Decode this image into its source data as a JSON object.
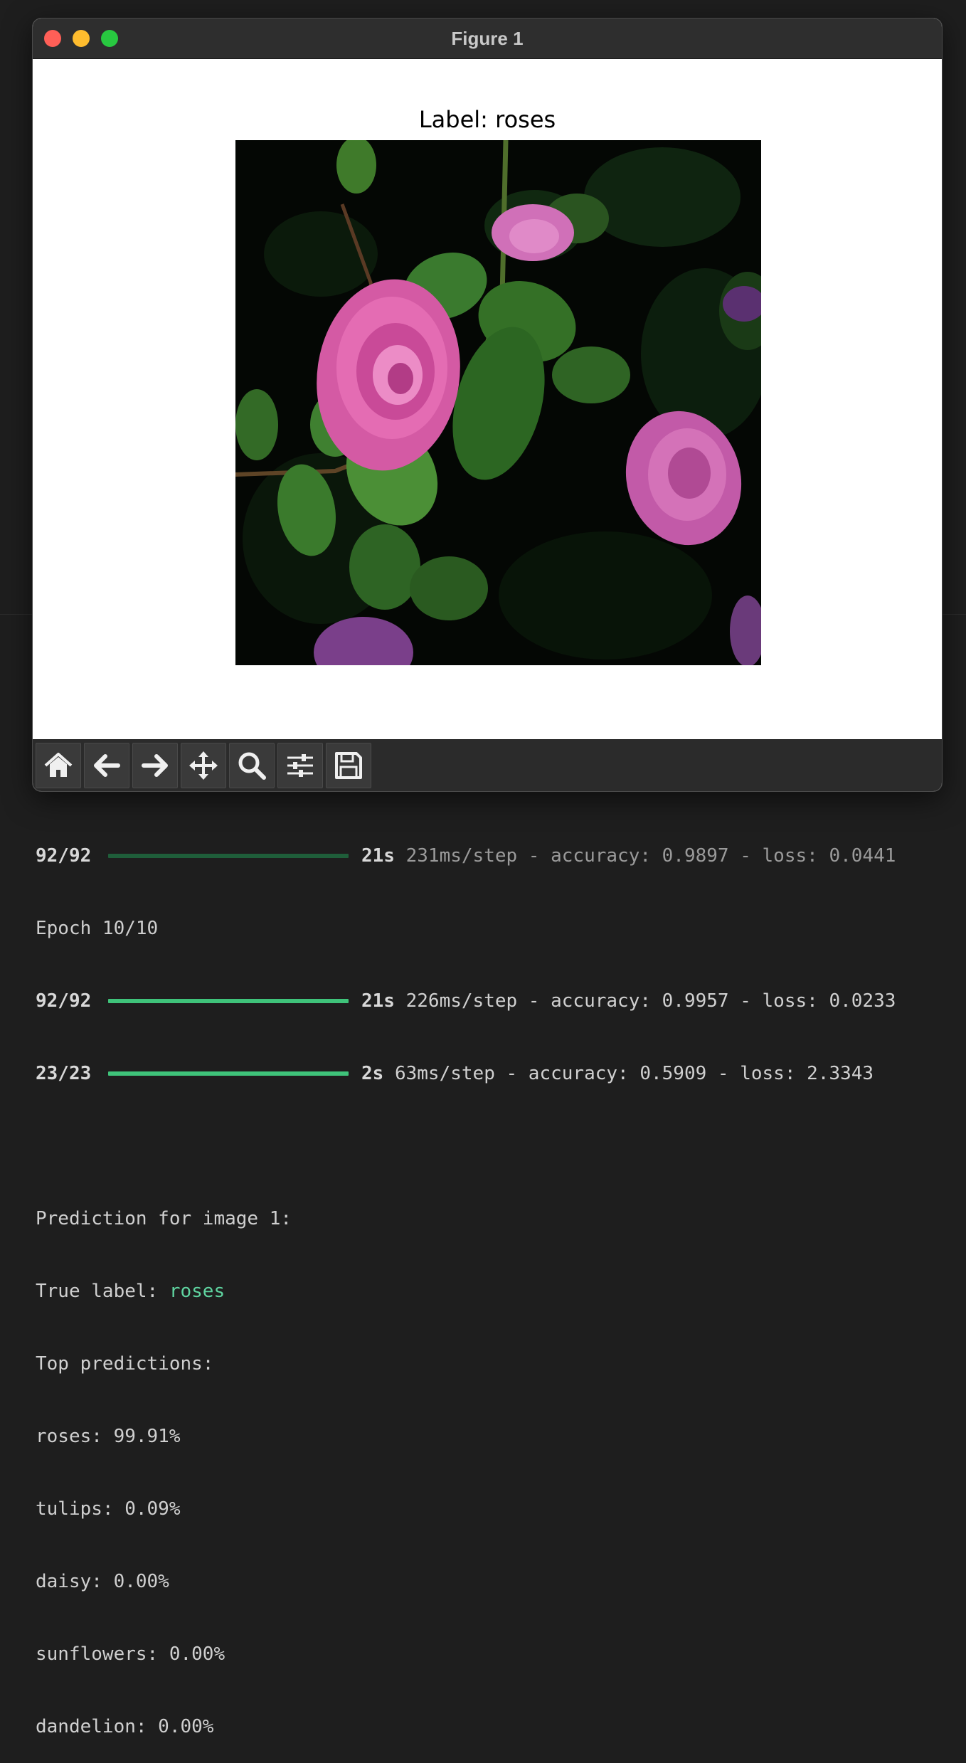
{
  "window": {
    "title": "Figure 1"
  },
  "plot": {
    "title": "Label: roses",
    "image_subject": "pink roses with green leaves on dark background"
  },
  "toolbar": {
    "tools": [
      {
        "name": "home",
        "icon": "home-icon"
      },
      {
        "name": "back",
        "icon": "arrow-left-icon"
      },
      {
        "name": "forward",
        "icon": "arrow-right-icon"
      },
      {
        "name": "pan",
        "icon": "move-icon"
      },
      {
        "name": "zoom",
        "icon": "magnifier-icon"
      },
      {
        "name": "configure-subplots",
        "icon": "sliders-icon"
      },
      {
        "name": "save",
        "icon": "floppy-disk-icon"
      }
    ]
  },
  "terminal": {
    "line1": {
      "step": "92/92",
      "time": "21s",
      "rest": "231ms/step - accuracy: 0.9897 - loss: 0.0441"
    },
    "epoch": "Epoch 10/10",
    "line2": {
      "step": "92/92",
      "time": "21s",
      "rest": "226ms/step - accuracy: 0.9957 - loss: 0.0233"
    },
    "line3": {
      "step": "23/23",
      "time": "2s",
      "rest": "63ms/step - accuracy: 0.5909 - loss: 2.3343"
    },
    "prediction_header": "Prediction for image 1:",
    "true_label_prefix": "True label: ",
    "true_label_value": "roses",
    "top_predictions_header": "Top predictions:",
    "predictions": [
      "roses: 99.91%",
      "tulips: 0.09%",
      "daisy: 0.00%",
      "sunflowers: 0.00%",
      "dandelion: 0.00%"
    ]
  },
  "colors": {
    "terminal_bg": "#1e1e1e",
    "progress_bright": "#3fc37a",
    "progress_dim": "#1f5e3a",
    "label_green": "#5fd4a0"
  }
}
